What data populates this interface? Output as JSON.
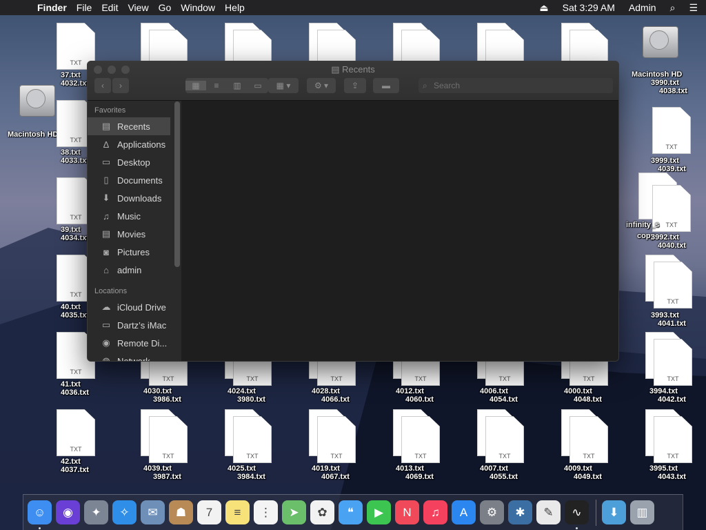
{
  "menubar": {
    "app_name": "Finder",
    "menus": [
      "File",
      "Edit",
      "View",
      "Go",
      "Window",
      "Help"
    ],
    "clock": "Sat 3:29 AM",
    "user": "Admin"
  },
  "window": {
    "title": "Recents",
    "search_placeholder": "Search",
    "sidebar": {
      "favorites_header": "Favorites",
      "favorites": [
        {
          "label": "Recents",
          "icon": "recents-icon"
        },
        {
          "label": "Applications",
          "icon": "applications-icon"
        },
        {
          "label": "Desktop",
          "icon": "desktop-icon"
        },
        {
          "label": "Documents",
          "icon": "documents-icon"
        },
        {
          "label": "Downloads",
          "icon": "downloads-icon"
        },
        {
          "label": "Music",
          "icon": "music-icon"
        },
        {
          "label": "Movies",
          "icon": "movies-icon"
        },
        {
          "label": "Pictures",
          "icon": "pictures-icon"
        },
        {
          "label": "admin",
          "icon": "home-icon"
        }
      ],
      "locations_header": "Locations",
      "locations": [
        {
          "label": "iCloud Drive",
          "icon": "cloud-icon"
        },
        {
          "label": "Dartz’s iMac",
          "icon": "imac-icon"
        },
        {
          "label": "Remote Di...",
          "icon": "disc-icon"
        },
        {
          "label": "Network",
          "icon": "network-icon"
        }
      ]
    }
  },
  "desktop": {
    "drive_left": "Macintosh HD",
    "drive_right": "Macintosh HD",
    "python_file": {
      "label1": "infinity_s",
      "label2": "copy",
      "badge": "PYT"
    },
    "doc_badge": "TXT",
    "file_labels": {
      "col1": [
        "37.txt",
        "4032.txt",
        "398",
        "38.txt",
        "4033.txt",
        "398",
        "39.txt",
        "4034.txt",
        "40.txt",
        "4035.txt",
        "41.txt",
        "4036.txt",
        "42.txt",
        "4037.txt"
      ],
      "row5": [
        "4030.txt",
        "3986.txt",
        "4024.txt",
        "3980.txt",
        "4028.txt",
        "4066.txt",
        "4012.txt",
        "4060.txt",
        "4006.txt",
        "4054.txt",
        "4000.txt",
        "4048.txt",
        "3994.txt",
        "4042.txt"
      ],
      "row6": [
        "4039.txt",
        "3987.txt",
        "4025.txt",
        "3984.txt",
        "4019.txt",
        "4067.txt",
        "4013.txt",
        "4069.txt",
        "4007.txt",
        "4055.txt",
        "4009.txt",
        "4049.txt",
        "3995.txt",
        "4043.txt"
      ],
      "right": [
        "3990.txt",
        "4038.txt",
        "3999.txt",
        "4039.txt",
        "3992.txt",
        "4040.txt",
        "3993.txt",
        "4041.txt"
      ]
    }
  },
  "dock": {
    "apps": [
      {
        "name": "finder-icon",
        "glyph": "☺",
        "color": "#3d8ef0",
        "running": true
      },
      {
        "name": "siri-icon",
        "glyph": "◉",
        "color": "#6a3fd6",
        "running": false
      },
      {
        "name": "launchpad-icon",
        "glyph": "✦",
        "color": "#7c8594",
        "running": false
      },
      {
        "name": "safari-icon",
        "glyph": "✧",
        "color": "#2f8fe8",
        "running": false
      },
      {
        "name": "mail-icon",
        "glyph": "✉",
        "color": "#6d8fb8",
        "running": false
      },
      {
        "name": "contacts-icon",
        "glyph": "☗",
        "color": "#b88a55",
        "running": false
      },
      {
        "name": "calendar-icon",
        "glyph": "7",
        "color": "#f2f2f2",
        "running": false
      },
      {
        "name": "notes-icon",
        "glyph": "≡",
        "color": "#f7e27a",
        "running": false
      },
      {
        "name": "reminders-icon",
        "glyph": "⋮",
        "color": "#f4f4f4",
        "running": false
      },
      {
        "name": "maps-icon",
        "glyph": "➤",
        "color": "#6bbf6a",
        "running": false
      },
      {
        "name": "photos-icon",
        "glyph": "✿",
        "color": "#f2f2f2",
        "running": false
      },
      {
        "name": "messages-icon",
        "glyph": "❝",
        "color": "#4aa3f2",
        "running": false
      },
      {
        "name": "facetime-icon",
        "glyph": "▶",
        "color": "#3cc651",
        "running": false
      },
      {
        "name": "news-icon",
        "glyph": "N",
        "color": "#f04a5a",
        "running": false
      },
      {
        "name": "music-icon",
        "glyph": "♫",
        "color": "#f3415e",
        "running": false
      },
      {
        "name": "app-store-icon",
        "glyph": "A",
        "color": "#2b86f0",
        "running": false
      },
      {
        "name": "system-preferences-icon",
        "glyph": "⚙",
        "color": "#7a7f88",
        "running": false
      },
      {
        "name": "python-launcher-icon",
        "glyph": "✱",
        "color": "#3b6fa4",
        "running": false
      },
      {
        "name": "text-edit-icon",
        "glyph": "✎",
        "color": "#e9e9e9",
        "running": false
      },
      {
        "name": "activity-monitor-icon",
        "glyph": "∿",
        "color": "#222",
        "running": true
      }
    ],
    "right": [
      {
        "name": "downloads-folder-icon",
        "glyph": "⬇",
        "color": "#4c9fd9"
      },
      {
        "name": "trash-icon",
        "glyph": "▥",
        "color": "#9aa2ad"
      }
    ]
  }
}
